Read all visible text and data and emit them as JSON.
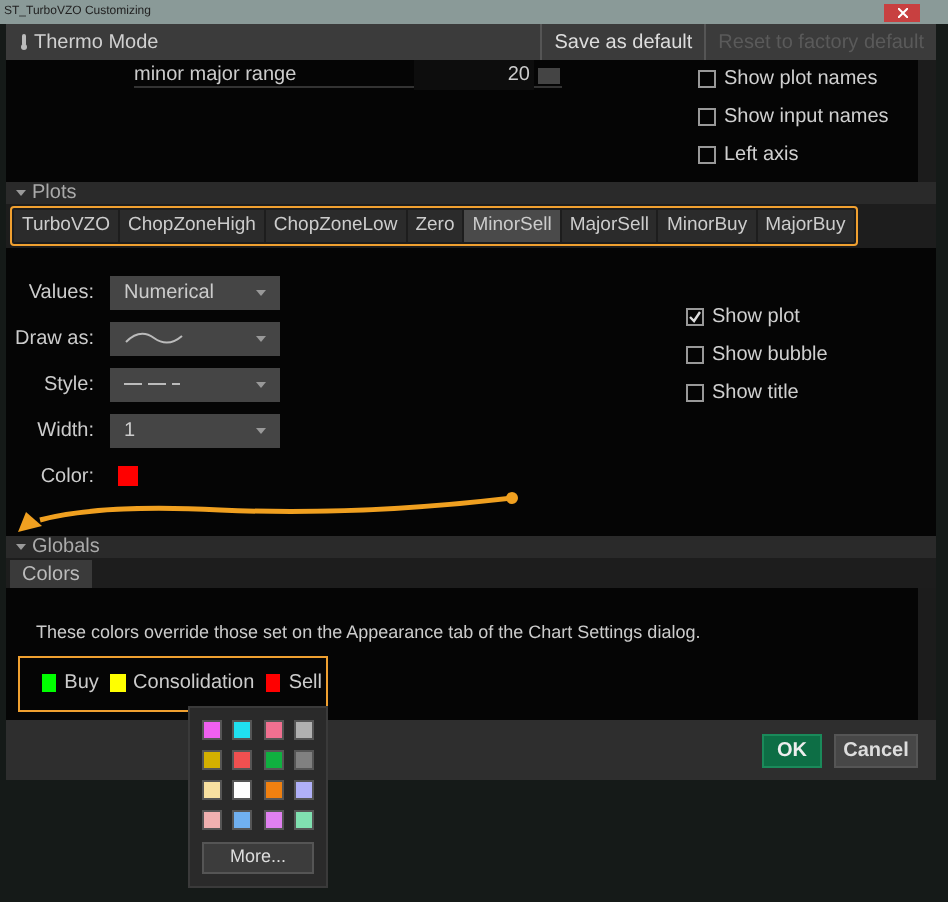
{
  "window": {
    "title": "ST_TurboVZO Customizing"
  },
  "toolbar": {
    "thermo_mode": "Thermo Mode",
    "buttons": [
      {
        "label": "Save as default",
        "disabled": false
      },
      {
        "label": "Reset to factory default",
        "disabled": true
      }
    ]
  },
  "inputs": [
    {
      "name": "minor major range",
      "value": "20"
    }
  ],
  "chart_options": [
    {
      "label": "Show plot names",
      "checked": false
    },
    {
      "label": "Show input names",
      "checked": false
    },
    {
      "label": "Left axis",
      "checked": false
    }
  ],
  "plots": {
    "title": "Plots",
    "expanded": true,
    "tabs": [
      {
        "label": "TurboVZO",
        "selected": false
      },
      {
        "label": "ChopZoneHigh",
        "selected": false
      },
      {
        "label": "ChopZoneLow",
        "selected": false
      },
      {
        "label": "Zero",
        "selected": false
      },
      {
        "label": "MinorSell",
        "selected": true
      },
      {
        "label": "MajorSell",
        "selected": false
      },
      {
        "label": "MinorBuy",
        "selected": false
      },
      {
        "label": "MajorBuy",
        "selected": false
      }
    ],
    "fields": [
      {
        "label": "Values:",
        "kind": "text",
        "value": "Numerical"
      },
      {
        "label": "Draw as:",
        "kind": "wave"
      },
      {
        "label": "Style:",
        "kind": "dash"
      },
      {
        "label": "Width:",
        "kind": "text",
        "value": "1"
      },
      {
        "label": "Color:",
        "kind": "color",
        "color": "#ff0000"
      }
    ],
    "options": [
      {
        "label": "Show plot",
        "checked": true
      },
      {
        "label": "Show bubble",
        "checked": false
      },
      {
        "label": "Show title",
        "checked": false
      }
    ]
  },
  "globals": {
    "title": "Globals",
    "expanded": true,
    "tabs": [
      {
        "label": "Colors",
        "selected": true
      }
    ],
    "note": "These colors override those set on the Appearance tab of the Chart Settings dialog.",
    "colors": [
      {
        "label": "Buy",
        "color": "#00ff00"
      },
      {
        "label": "Consolidation",
        "color": "#ffff00"
      },
      {
        "label": "Sell",
        "color": "#ff0000"
      }
    ]
  },
  "palette": {
    "swatches": [
      {
        "color": "#f060f0"
      },
      {
        "color": "#20e0f0"
      },
      {
        "color": "#f07090"
      },
      {
        "color": "#b0b0b0"
      },
      {
        "color": "#d4b000"
      },
      {
        "color": "#f05050"
      },
      {
        "color": "#10b040"
      },
      {
        "color": "#808080"
      },
      {
        "color": "#f8e0a0"
      },
      {
        "color": "#ffffff"
      },
      {
        "color": "#f08010"
      },
      {
        "color": "#b0b0f8"
      },
      {
        "color": "#f0b0b0"
      },
      {
        "color": "#70b0f0"
      },
      {
        "color": "#e080f0"
      },
      {
        "color": "#80e0b0"
      }
    ],
    "more": "More..."
  },
  "footer": {
    "ok": "OK",
    "cancel": "Cancel"
  }
}
